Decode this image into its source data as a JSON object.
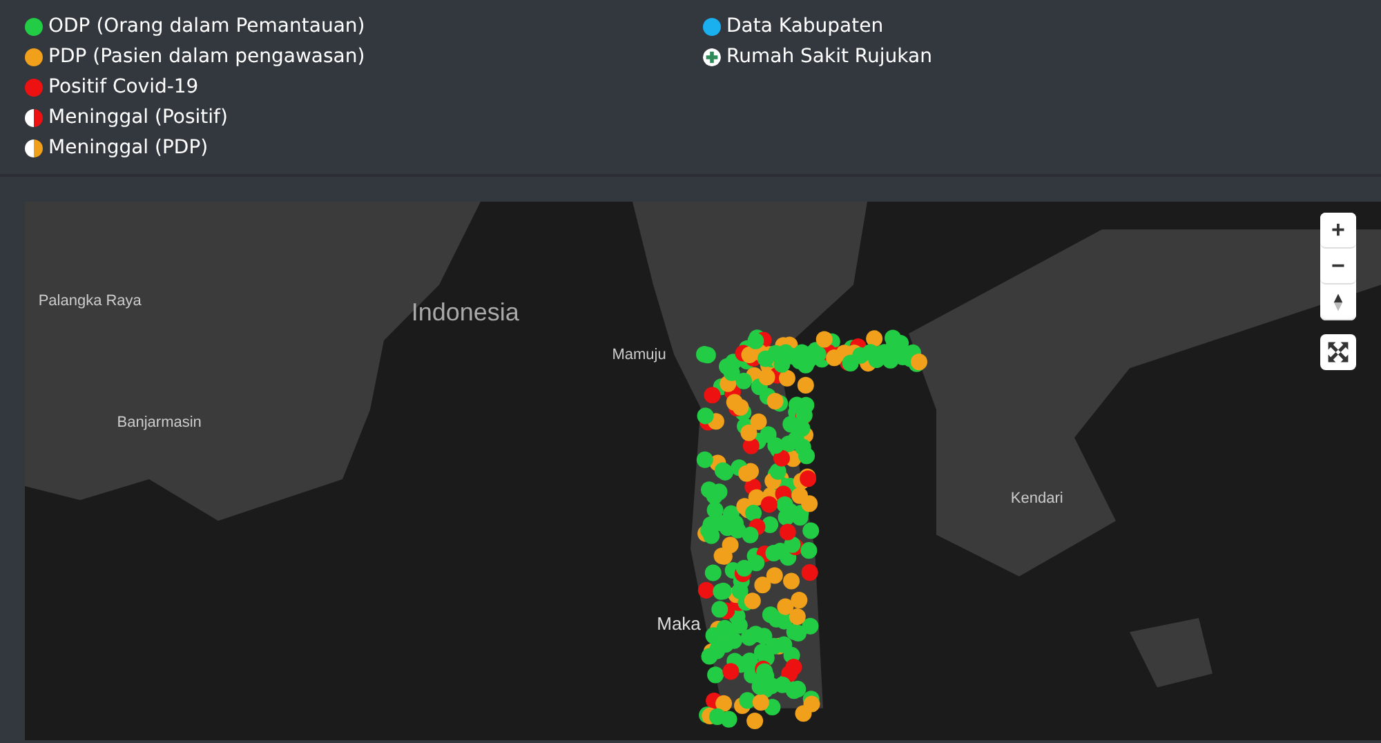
{
  "legend": {
    "columns": [
      [
        {
          "kind": "dot",
          "color": "#22cc44",
          "label": "ODP (Orang dalam Pemantauan)"
        },
        {
          "kind": "dot",
          "color": "#f0a01a",
          "label": "PDP (Pasien dalam pengawasan)"
        },
        {
          "kind": "dot",
          "color": "#ee1111",
          "label": "Positif Covid-19"
        },
        {
          "kind": "half",
          "color": "#ee1111",
          "label": "Meninggal (Positif)"
        },
        {
          "kind": "half",
          "color": "#f0a01a",
          "label": "Meninggal (PDP)"
        }
      ],
      [
        {
          "kind": "dot",
          "color": "#1ab0f0",
          "label": "Data Kabupaten"
        },
        {
          "kind": "plus",
          "color": "#2e8b57",
          "label": "Rumah Sakit Rujukan"
        }
      ]
    ]
  },
  "map": {
    "labels": [
      {
        "text": "Palangka Raya",
        "kind": "city"
      },
      {
        "text": "Indonesia",
        "kind": "country"
      },
      {
        "text": "Mamuju",
        "kind": "city"
      },
      {
        "text": "Banjarmasin",
        "kind": "city"
      },
      {
        "text": "Kendari",
        "kind": "city"
      },
      {
        "text": "Maka",
        "kind": "city-large"
      }
    ],
    "controls": [
      {
        "kind": "zoom-in",
        "label": "+"
      },
      {
        "kind": "zoom-out",
        "label": "−"
      },
      {
        "kind": "compass"
      }
    ]
  }
}
